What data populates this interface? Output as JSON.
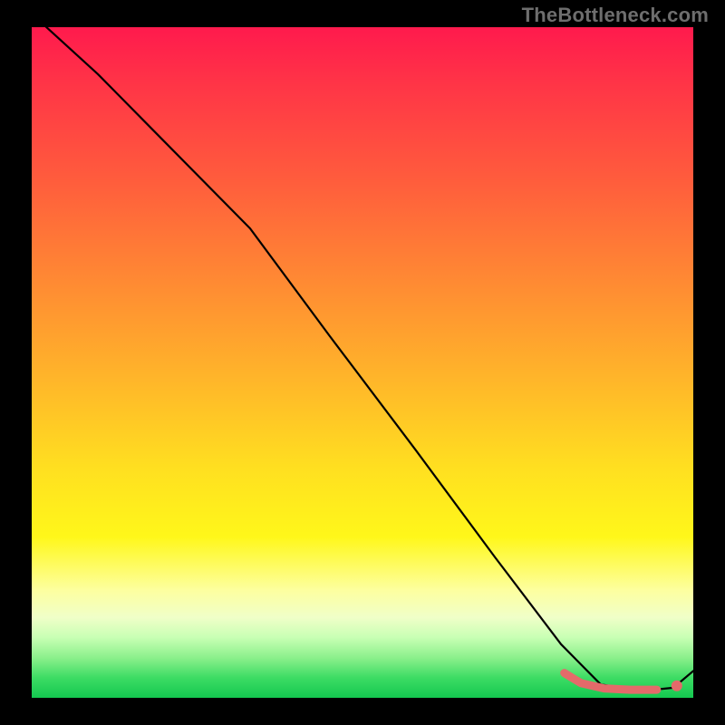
{
  "watermark": "TheBottleneck.com",
  "colors": {
    "background_frame": "#000000",
    "marker": "#e46a6a",
    "curve": "#000000",
    "gradient_stops": [
      "#ff1a4d",
      "#ff3347",
      "#ff5a3d",
      "#ff8a33",
      "#ffb42a",
      "#ffe020",
      "#fff71a",
      "#fdffa0",
      "#f0ffc8",
      "#c8ffb4",
      "#8cf08c",
      "#3ddc64",
      "#14c850"
    ]
  },
  "chart_data": {
    "type": "line",
    "title": "",
    "xlabel": "",
    "ylabel": "",
    "xlim": [
      0,
      1
    ],
    "ylim": [
      0,
      1
    ],
    "grid": false,
    "legend": false,
    "series": [
      {
        "name": "bottleneck-curve",
        "x": [
          0.0,
          0.1,
          0.2,
          0.27,
          0.33,
          0.45,
          0.58,
          0.7,
          0.8,
          0.86,
          0.92,
          0.97,
          1.0
        ],
        "y": [
          1.02,
          0.93,
          0.83,
          0.76,
          0.7,
          0.54,
          0.37,
          0.21,
          0.08,
          0.02,
          0.01,
          0.015,
          0.04
        ]
      }
    ],
    "annotations": [
      {
        "name": "optimal-region-track",
        "type": "polyline",
        "x": [
          0.805,
          0.83,
          0.865,
          0.905,
          0.945
        ],
        "y": [
          0.037,
          0.022,
          0.014,
          0.012,
          0.012
        ]
      },
      {
        "name": "optimal-region-dot",
        "type": "point",
        "x": 0.975,
        "y": 0.018
      }
    ],
    "notes": "Axes are unlabeled in the source image; x and y are normalized 0..1 with y increasing upward. Values are read from pixel positions and rounded to ~0.01."
  }
}
